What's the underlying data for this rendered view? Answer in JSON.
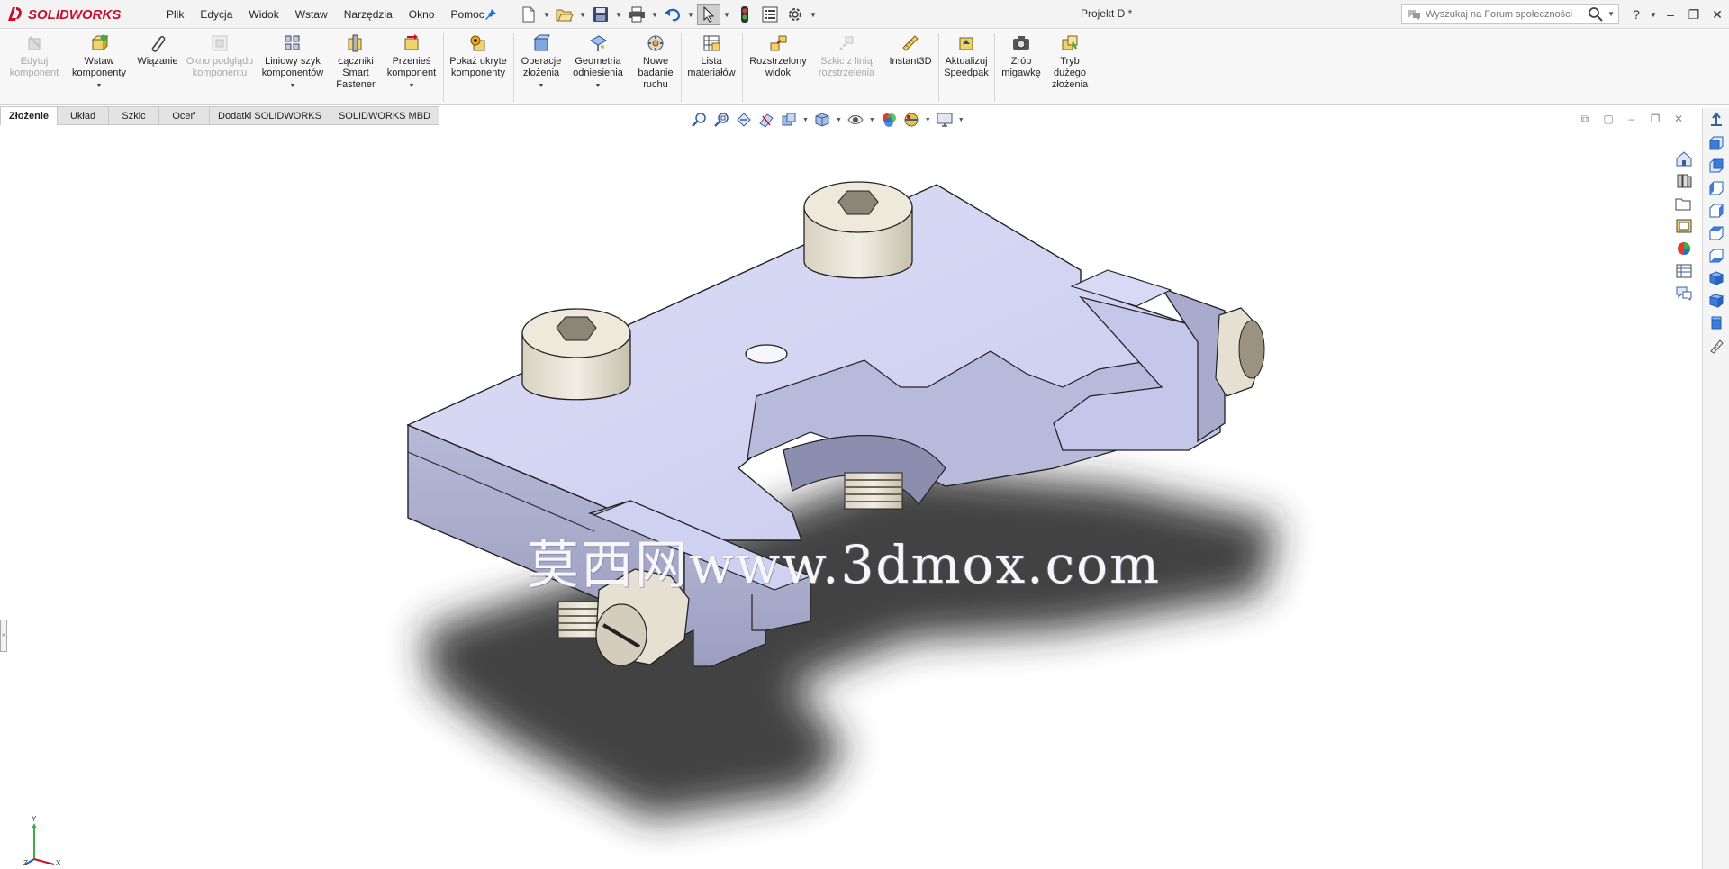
{
  "app": {
    "logo_text": "SOLIDWORKS",
    "document_title": "Projekt D *"
  },
  "menu": [
    "Plik",
    "Edycja",
    "Widok",
    "Wstaw",
    "Narzędzia",
    "Okno",
    "Pomoc"
  ],
  "search": {
    "placeholder": "Wyszukaj na Forum społeczności"
  },
  "window_controls": {
    "help": "?",
    "minimize": "–",
    "restore": "❐",
    "close": "✕"
  },
  "ribbon": {
    "edit_component": "Edytuj komponent",
    "insert_components": "Wstaw komponenty",
    "mate": "Wiązanie",
    "component_preview": "Okno podglądu komponentu",
    "linear_pattern": "Liniowy szyk komponentów",
    "smart_fasteners": "Łączniki Smart Fastener",
    "move_component": "Przenieś komponent",
    "show_hidden": "Pokaż ukryte komponenty",
    "assembly_features": "Operacje złożenia",
    "reference_geometry": "Geometria odniesienia",
    "new_motion_study": "Nowe badanie ruchu",
    "bill_of_materials": "Lista materiałów",
    "exploded_view": "Rozstrzelony widok",
    "explode_line_sketch": "Szkic z linią rozstrzelenia",
    "instant3d": "Instant3D",
    "update_speedpak": "Aktualizuj Speedpak",
    "take_snapshot": "Zrób migawkę",
    "large_assembly_mode": "Tryb dużego złożenia"
  },
  "tabs": [
    "Złożenie",
    "Układ",
    "Szkic",
    "Oceń",
    "Dodatki SOLIDWORKS",
    "SOLIDWORKS MBD"
  ],
  "active_tab": "Złożenie",
  "viewport": {
    "watermark": "莫西网www.3dmox.com"
  },
  "triad": {
    "x": "X",
    "y": "Y",
    "z": "Z"
  },
  "colors": {
    "brand_red": "#c8102e",
    "model_face": "#d6d8f2",
    "model_side": "#a7a9c9",
    "screw_color": "#e3ddcf"
  }
}
